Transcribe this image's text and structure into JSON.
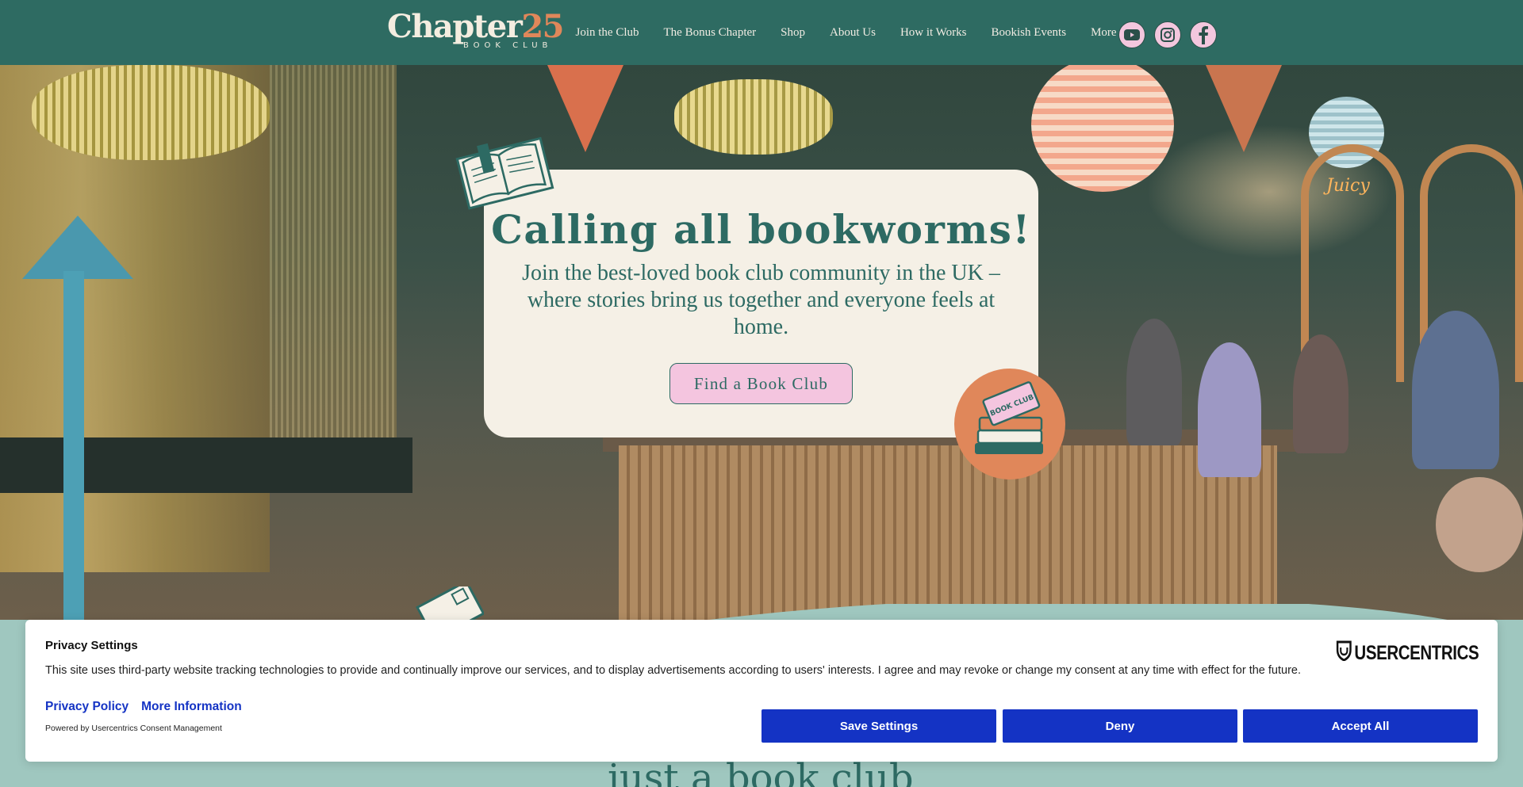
{
  "header": {
    "logo_main": "Chapter",
    "logo_number": "25",
    "logo_sub": "BOOK CLUB",
    "nav": [
      "Join the Club",
      "The Bonus Chapter",
      "Shop",
      "About Us",
      "How it Works",
      "Bookish Events",
      "More"
    ],
    "social": [
      "youtube-icon",
      "instagram-icon",
      "facebook-icon"
    ]
  },
  "hero": {
    "title": "Calling all bookworms!",
    "subtitle": "Join the best-loved book club community in the UK – where stories bring us together and everyone feels at home.",
    "cta": "Find a Book Club",
    "sticker_text": "BOOK CLUB",
    "neon_sign": "Juicy"
  },
  "below_fold_text": "just a book club",
  "consent": {
    "title": "Privacy Settings",
    "text": "This site uses third-party website tracking technologies to provide and continually improve our services, and to display advertisements according to users' interests. I agree and may revoke or change my consent at any time with effect for the future.",
    "links": [
      "Privacy Policy",
      "More Information"
    ],
    "powered_by": "Powered by Usercentrics Consent Management",
    "brand": "USERCENTRICS",
    "buttons": {
      "save": "Save Settings",
      "deny": "Deny",
      "accept": "Accept All"
    }
  },
  "colors": {
    "header_bg": "#2e6b62",
    "accent_teal": "#2d6a63",
    "card_bg": "#f5f0e6",
    "cta_pink": "#f4c5df",
    "consent_blue": "#1433c4",
    "logo_orange": "#e0875a"
  }
}
